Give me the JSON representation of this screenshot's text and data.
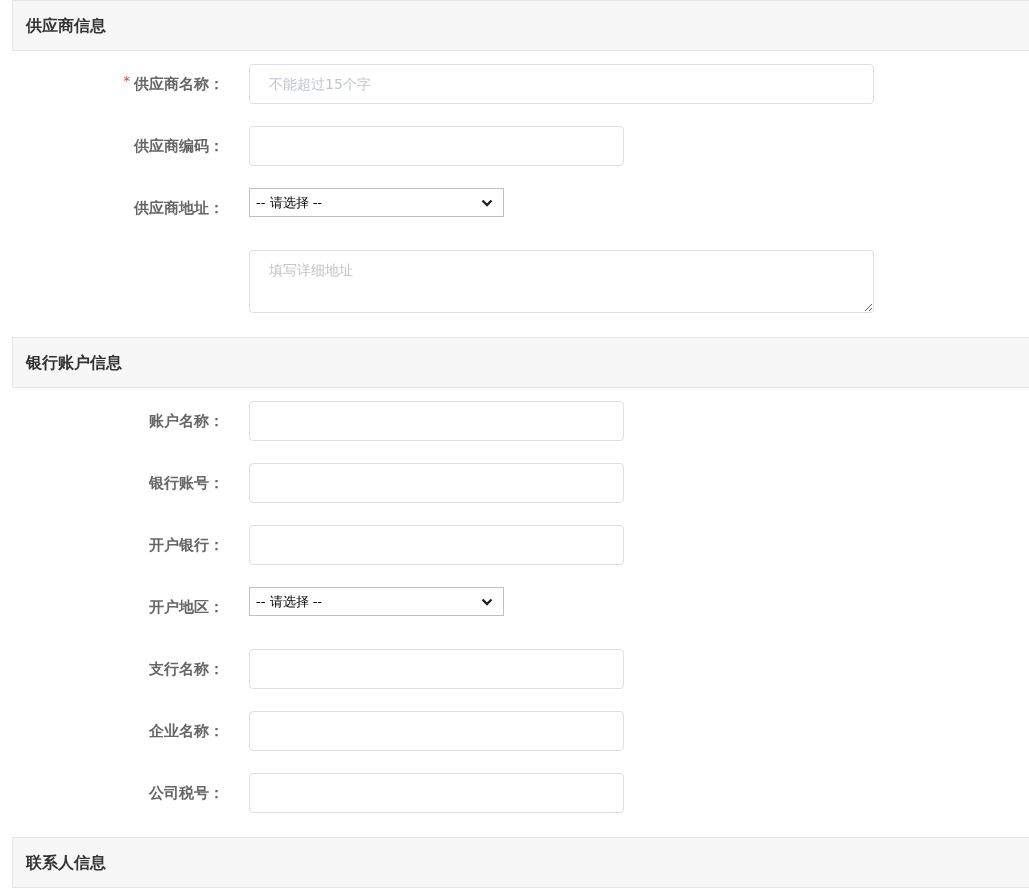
{
  "sections": [
    {
      "title": "供应商信息",
      "fields": [
        {
          "kind": "wide_input",
          "mark": "*",
          "label": "供应商名称：",
          "placeholder": "不能超过15个字"
        },
        {
          "kind": "input",
          "label": "供应商编码："
        },
        {
          "kind": "select",
          "label": "供应商地址：",
          "value": "-- 请选择 --"
        },
        {
          "kind": "textarea",
          "placeholder": "填写详细地址"
        }
      ]
    },
    {
      "title": "银行账户信息",
      "fields": [
        {
          "kind": "input",
          "label": "账户名称："
        },
        {
          "kind": "input",
          "label": "银行账号："
        },
        {
          "kind": "input",
          "label": "开户银行："
        },
        {
          "kind": "select",
          "label": "开户地区：",
          "value": "-- 请选择 --"
        },
        {
          "kind": "input",
          "label": "支行名称："
        },
        {
          "kind": "input",
          "label": "企业名称："
        },
        {
          "kind": "input",
          "label": "公司税号："
        }
      ]
    },
    {
      "title": "联系人信息"
    }
  ]
}
